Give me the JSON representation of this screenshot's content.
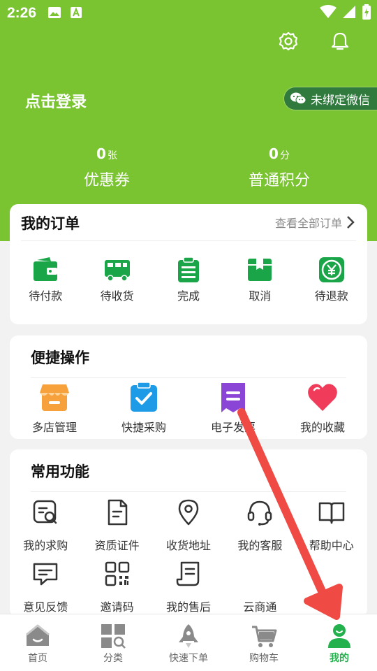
{
  "status_bar": {
    "time": "2:26"
  },
  "header": {
    "login_text": "点击登录",
    "wechat_label": "未绑定微信"
  },
  "stats": [
    {
      "value": "0",
      "unit": "张",
      "label": "优惠券"
    },
    {
      "value": "0",
      "unit": "分",
      "label": "普通积分"
    }
  ],
  "orders": {
    "title": "我的订单",
    "view_all": "查看全部订单",
    "items": [
      {
        "label": "待付款",
        "icon": "wallet-icon"
      },
      {
        "label": "待收货",
        "icon": "truck-icon"
      },
      {
        "label": "完成",
        "icon": "clipboard-list-icon"
      },
      {
        "label": "取消",
        "icon": "box-icon"
      },
      {
        "label": "待退款",
        "icon": "refund-icon"
      }
    ]
  },
  "quick": {
    "title": "便捷操作",
    "items": [
      {
        "label": "多店管理",
        "icon": "store-icon"
      },
      {
        "label": "快捷采购",
        "icon": "checklist-icon"
      },
      {
        "label": "电子发票",
        "icon": "invoice-icon"
      },
      {
        "label": "我的收藏",
        "icon": "heart-icon"
      }
    ]
  },
  "common": {
    "title": "常用功能",
    "items": [
      {
        "label": "我的求购",
        "icon": "search-document-icon"
      },
      {
        "label": "资质证件",
        "icon": "certificate-icon"
      },
      {
        "label": "收货地址",
        "icon": "location-pin-icon"
      },
      {
        "label": "我的客服",
        "icon": "headset-icon"
      },
      {
        "label": "帮助中心",
        "icon": "book-icon"
      },
      {
        "label": "意见反馈",
        "icon": "feedback-icon"
      },
      {
        "label": "邀请码",
        "icon": "qr-code-icon"
      },
      {
        "label": "我的售后",
        "icon": "scroll-icon"
      },
      {
        "label": "云商通",
        "icon": "none"
      }
    ]
  },
  "tabbar": [
    {
      "label": "首页",
      "icon": "home-icon",
      "active": false
    },
    {
      "label": "分类",
      "icon": "category-icon",
      "active": false
    },
    {
      "label": "快速下单",
      "icon": "rocket-icon",
      "active": false
    },
    {
      "label": "购物车",
      "icon": "cart-icon",
      "active": false
    },
    {
      "label": "我的",
      "icon": "user-icon",
      "active": true
    }
  ],
  "colors": {
    "brand_green": "#7ac331",
    "icon_green": "#1aa548",
    "active_tab": "#22b14c",
    "annotation_red": "#f04a45"
  }
}
